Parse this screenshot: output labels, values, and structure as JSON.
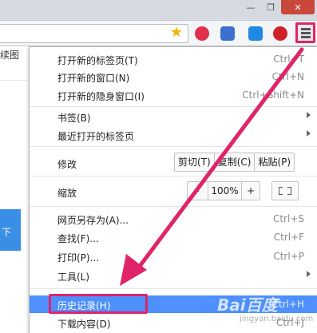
{
  "window": {
    "minimize_glyph": "—",
    "maximize_glyph": "❐",
    "close_glyph": "✕"
  },
  "toolbar": {
    "star_glyph": "★",
    "icons": [
      "bookmark-star-icon",
      "extension-red-icon",
      "extension-blue-icon",
      "extension-lightblue-icon",
      "adblock-stop-icon",
      "hamburger-menu-icon"
    ]
  },
  "page": {
    "bookmarks_stub": "续图",
    "blue_button_text": "下"
  },
  "menu": {
    "items": [
      {
        "label": "打开新的标签页(T)",
        "shortcut": "Ctrl+T"
      },
      {
        "label": "打开新的窗口(N)",
        "shortcut": "Ctrl+N"
      },
      {
        "label": "打开新的隐身窗口(I)",
        "shortcut": "Ctrl+Shift+N"
      },
      {
        "label": "书签(B)",
        "shortcut": ""
      },
      {
        "label": "最近打开的标签页",
        "shortcut": ""
      },
      {
        "label": "修改",
        "shortcut": ""
      },
      {
        "label": "缩放",
        "shortcut": ""
      },
      {
        "label": "网页另存为(A)...",
        "shortcut": "Ctrl+S"
      },
      {
        "label": "查找(F)...",
        "shortcut": "Ctrl+F"
      },
      {
        "label": "打印(P)...",
        "shortcut": "Ctrl+P"
      },
      {
        "label": "工具(L)",
        "shortcut": ""
      },
      {
        "label": "历史记录(H)",
        "shortcut": "Ctrl+H"
      },
      {
        "label": "下载内容(D)",
        "shortcut": "Ctrl+J"
      }
    ],
    "edit": {
      "cut": "剪切(T)",
      "copy": "复制(C)",
      "paste": "粘贴(P)"
    },
    "zoom": {
      "minus": "-",
      "value": "100%",
      "plus": "+"
    }
  },
  "watermark": {
    "logo": "Bai百度",
    "sub": "jingyan.baidu.com"
  },
  "colors": {
    "highlight": "#4d90fe",
    "annotation": "#e0246a"
  }
}
